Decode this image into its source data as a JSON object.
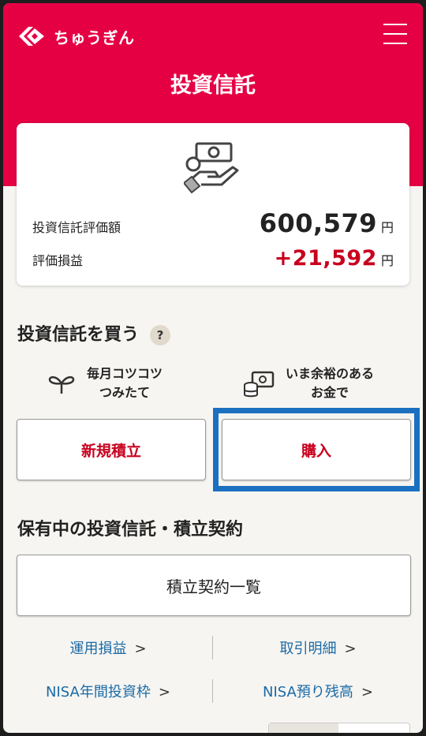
{
  "header": {
    "brand": "ちゅうぎん",
    "title": "投資信託",
    "menu_icon": "hamburger-menu-icon"
  },
  "summary": {
    "icon": "money-hand-icon",
    "valuation_label": "投資信託評価額",
    "valuation_value": "600,579",
    "valuation_unit": "円",
    "gain_label": "評価損益",
    "gain_value": "+21,592",
    "gain_unit": "円",
    "gain_color": "#c8001e"
  },
  "buy": {
    "title": "投資信託を買う",
    "help": "?",
    "monthly_hint": "毎月コツコツ\nつみたて",
    "monthly_icon": "sprout-icon",
    "lump_hint": "いま余裕のある\nお金で",
    "lump_icon": "coin-stack-icon",
    "new_plan_label": "新規積立",
    "purchase_label": "購入"
  },
  "holdings": {
    "title": "保有中の投資信託・積立契約",
    "contracts_label": "積立契約一覧"
  },
  "links": {
    "profit": "運用損益",
    "transactions": "取引明細",
    "nisa_quota": "NISA年間投資枠",
    "nisa_balance": "NISA預り残高"
  },
  "colors": {
    "brand_red": "#e50044",
    "link_blue": "#1a6aa6",
    "highlight_blue": "#1b70c0"
  }
}
